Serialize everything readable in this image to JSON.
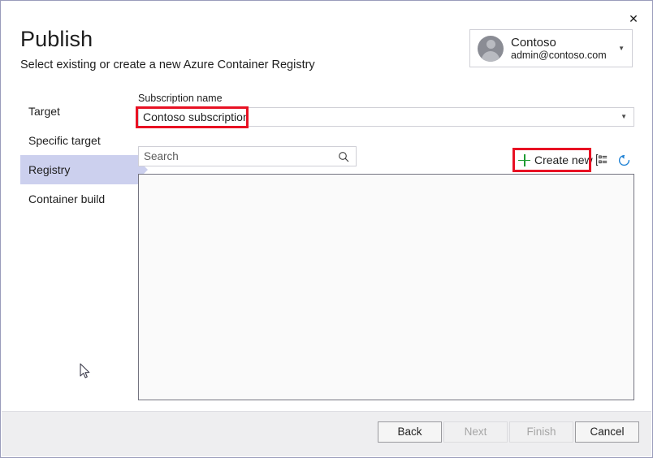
{
  "window": {
    "close_label": "✕"
  },
  "header": {
    "title": "Publish",
    "subtitle": "Select existing or create a new Azure Container Registry"
  },
  "account": {
    "name": "Contoso",
    "email": "admin@contoso.com",
    "caret": "▼",
    "avatar_icon": "person-avatar-icon"
  },
  "sidebar": {
    "items": [
      {
        "label": "Target",
        "selected": false
      },
      {
        "label": "Specific target",
        "selected": false
      },
      {
        "label": "Registry",
        "selected": true
      },
      {
        "label": "Container build",
        "selected": false
      }
    ]
  },
  "main": {
    "subscription": {
      "label": "Subscription name",
      "value": "Contoso subscription",
      "caret": "▼"
    },
    "search": {
      "value": "",
      "placeholder": "Search",
      "icon": "search-icon"
    },
    "toolbar": {
      "create_new_label": "Create new",
      "plus_icon": "plus-icon",
      "detail_view_icon": "detail-view-icon",
      "refresh_icon": "refresh-icon"
    },
    "registry_list": {
      "items": []
    }
  },
  "footer": {
    "buttons": [
      {
        "label": "Back",
        "enabled": true
      },
      {
        "label": "Next",
        "enabled": false
      },
      {
        "label": "Finish",
        "enabled": false
      },
      {
        "label": "Cancel",
        "enabled": true
      }
    ]
  },
  "annotations": [
    {
      "name": "subscription-highlight",
      "color": "#e81123"
    },
    {
      "name": "create-new-highlight",
      "color": "#e81123"
    }
  ],
  "colors": {
    "accent_selection": "#ccd0ee",
    "window_border": "#9a9cbb",
    "annotation_red": "#e81123",
    "plus_green": "#1f9b32",
    "refresh_blue": "#0078d4"
  }
}
